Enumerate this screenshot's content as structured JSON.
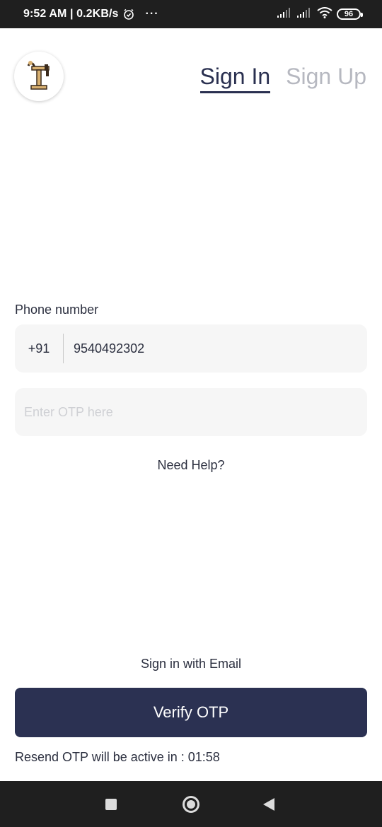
{
  "status_bar": {
    "time_speed": "9:52 AM | 0.2KB/s",
    "overflow": "···",
    "battery": "96",
    "icons": [
      "alarm-icon",
      "signal-icon",
      "signal-icon",
      "wifi-icon",
      "battery-icon"
    ]
  },
  "header": {
    "logo_icon": "lamp-logo-icon",
    "tabs": [
      {
        "label": "Sign In",
        "active": true
      },
      {
        "label": "Sign Up",
        "active": false
      }
    ]
  },
  "form": {
    "phone_label": "Phone number",
    "country_code": "+91",
    "phone_value": "9540492302",
    "otp_placeholder": "Enter OTP here",
    "otp_value": "",
    "help_link": "Need Help?",
    "email_link": "Sign in with Email",
    "verify_button": "Verify OTP",
    "resend_text": "Resend OTP will be active in : 01:58"
  },
  "nav": {
    "icons": [
      "recent-apps-icon",
      "home-icon",
      "back-icon"
    ]
  },
  "colors": {
    "primary": "#2b3152",
    "field_bg": "#f6f6f6",
    "inactive_tab": "#b6b8c0"
  }
}
